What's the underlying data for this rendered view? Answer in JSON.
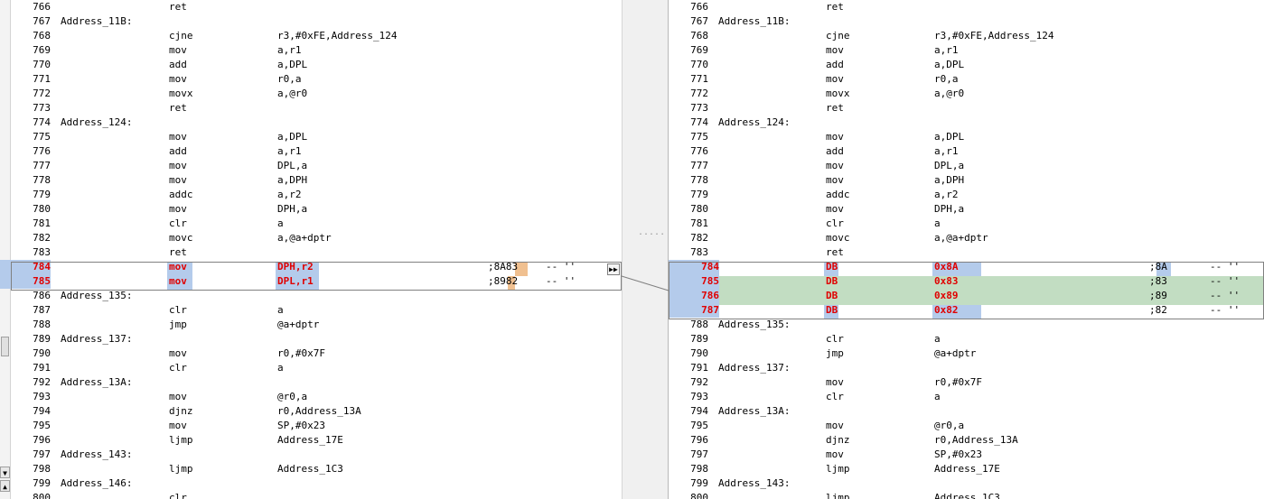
{
  "left": {
    "rows": [
      {
        "ln": "766",
        "label": "",
        "mn": "ret",
        "op": "",
        "cm": "",
        "as": ""
      },
      {
        "ln": "767",
        "label": "Address_11B:",
        "mn": "",
        "op": "",
        "cm": "",
        "as": ""
      },
      {
        "ln": "768",
        "label": "",
        "mn": "cjne",
        "op": "r3,#0xFE,Address_124",
        "cm": "",
        "as": ""
      },
      {
        "ln": "769",
        "label": "",
        "mn": "mov",
        "op": "a,r1",
        "cm": "",
        "as": ""
      },
      {
        "ln": "770",
        "label": "",
        "mn": "add",
        "op": "a,DPL",
        "cm": "",
        "as": ""
      },
      {
        "ln": "771",
        "label": "",
        "mn": "mov",
        "op": "r0,a",
        "cm": "",
        "as": ""
      },
      {
        "ln": "772",
        "label": "",
        "mn": "movx",
        "op": "a,@r0",
        "cm": "",
        "as": ""
      },
      {
        "ln": "773",
        "label": "",
        "mn": "ret",
        "op": "",
        "cm": "",
        "as": ""
      },
      {
        "ln": "774",
        "label": "Address_124:",
        "mn": "",
        "op": "",
        "cm": "",
        "as": ""
      },
      {
        "ln": "775",
        "label": "",
        "mn": "mov",
        "op": "a,DPL",
        "cm": "",
        "as": ""
      },
      {
        "ln": "776",
        "label": "",
        "mn": "add",
        "op": "a,r1",
        "cm": "",
        "as": ""
      },
      {
        "ln": "777",
        "label": "",
        "mn": "mov",
        "op": "DPL,a",
        "cm": "",
        "as": ""
      },
      {
        "ln": "778",
        "label": "",
        "mn": "mov",
        "op": "a,DPH",
        "cm": "",
        "as": ""
      },
      {
        "ln": "779",
        "label": "",
        "mn": "addc",
        "op": "a,r2",
        "cm": "",
        "as": ""
      },
      {
        "ln": "780",
        "label": "",
        "mn": "mov",
        "op": "DPH,a",
        "cm": "",
        "as": ""
      },
      {
        "ln": "781",
        "label": "",
        "mn": "clr",
        "op": "a",
        "cm": "",
        "as": ""
      },
      {
        "ln": "782",
        "label": "",
        "mn": "movc",
        "op": "a,@a+dptr",
        "cm": "",
        "as": ""
      },
      {
        "ln": "783",
        "label": "",
        "mn": "ret",
        "op": "",
        "cm": "",
        "as": ""
      },
      {
        "ln": "784",
        "label": "",
        "mn": "mov",
        "op": "DPH,r2",
        "cm": ";8A83",
        "as": "-- ''",
        "diff": true
      },
      {
        "ln": "785",
        "label": "",
        "mn": "mov",
        "op": "DPL,r1",
        "cm": ";8982",
        "as": "-- ''",
        "diff": true
      },
      {
        "ln": "786",
        "label": "Address_135:",
        "mn": "",
        "op": "",
        "cm": "",
        "as": ""
      },
      {
        "ln": "787",
        "label": "",
        "mn": "clr",
        "op": "a",
        "cm": "",
        "as": ""
      },
      {
        "ln": "788",
        "label": "",
        "mn": "jmp",
        "op": "@a+dptr",
        "cm": "",
        "as": ""
      },
      {
        "ln": "789",
        "label": "Address_137:",
        "mn": "",
        "op": "",
        "cm": "",
        "as": ""
      },
      {
        "ln": "790",
        "label": "",
        "mn": "mov",
        "op": "r0,#0x7F",
        "cm": "",
        "as": ""
      },
      {
        "ln": "791",
        "label": "",
        "mn": "clr",
        "op": "a",
        "cm": "",
        "as": ""
      },
      {
        "ln": "792",
        "label": "Address_13A:",
        "mn": "",
        "op": "",
        "cm": "",
        "as": ""
      },
      {
        "ln": "793",
        "label": "",
        "mn": "mov",
        "op": "@r0,a",
        "cm": "",
        "as": ""
      },
      {
        "ln": "794",
        "label": "",
        "mn": "djnz",
        "op": "r0,Address_13A",
        "cm": "",
        "as": ""
      },
      {
        "ln": "795",
        "label": "",
        "mn": "mov",
        "op": "SP,#0x23",
        "cm": "",
        "as": ""
      },
      {
        "ln": "796",
        "label": "",
        "mn": "ljmp",
        "op": "Address_17E",
        "cm": "",
        "as": ""
      },
      {
        "ln": "797",
        "label": "Address_143:",
        "mn": "",
        "op": "",
        "cm": "",
        "as": ""
      },
      {
        "ln": "798",
        "label": "",
        "mn": "ljmp",
        "op": "Address_1C3",
        "cm": "",
        "as": ""
      },
      {
        "ln": "799",
        "label": "Address_146:",
        "mn": "",
        "op": "",
        "cm": "",
        "as": ""
      },
      {
        "ln": "800",
        "label": "",
        "mn": "clr",
        "op": "",
        "cm": "",
        "as": ""
      }
    ]
  },
  "right": {
    "rows": [
      {
        "ln": "766",
        "label": "",
        "mn": "ret",
        "op": "",
        "cm": "",
        "as": ""
      },
      {
        "ln": "767",
        "label": "Address_11B:",
        "mn": "",
        "op": "",
        "cm": "",
        "as": ""
      },
      {
        "ln": "768",
        "label": "",
        "mn": "cjne",
        "op": "r3,#0xFE,Address_124",
        "cm": "",
        "as": ""
      },
      {
        "ln": "769",
        "label": "",
        "mn": "mov",
        "op": "a,r1",
        "cm": "",
        "as": ""
      },
      {
        "ln": "770",
        "label": "",
        "mn": "add",
        "op": "a,DPL",
        "cm": "",
        "as": ""
      },
      {
        "ln": "771",
        "label": "",
        "mn": "mov",
        "op": "r0,a",
        "cm": "",
        "as": ""
      },
      {
        "ln": "772",
        "label": "",
        "mn": "movx",
        "op": "a,@r0",
        "cm": "",
        "as": ""
      },
      {
        "ln": "773",
        "label": "",
        "mn": "ret",
        "op": "",
        "cm": "",
        "as": ""
      },
      {
        "ln": "774",
        "label": "Address_124:",
        "mn": "",
        "op": "",
        "cm": "",
        "as": ""
      },
      {
        "ln": "775",
        "label": "",
        "mn": "mov",
        "op": "a,DPL",
        "cm": "",
        "as": ""
      },
      {
        "ln": "776",
        "label": "",
        "mn": "add",
        "op": "a,r1",
        "cm": "",
        "as": ""
      },
      {
        "ln": "777",
        "label": "",
        "mn": "mov",
        "op": "DPL,a",
        "cm": "",
        "as": ""
      },
      {
        "ln": "778",
        "label": "",
        "mn": "mov",
        "op": "a,DPH",
        "cm": "",
        "as": ""
      },
      {
        "ln": "779",
        "label": "",
        "mn": "addc",
        "op": "a,r2",
        "cm": "",
        "as": ""
      },
      {
        "ln": "780",
        "label": "",
        "mn": "mov",
        "op": "DPH,a",
        "cm": "",
        "as": ""
      },
      {
        "ln": "781",
        "label": "",
        "mn": "clr",
        "op": "a",
        "cm": "",
        "as": ""
      },
      {
        "ln": "782",
        "label": "",
        "mn": "movc",
        "op": "a,@a+dptr",
        "cm": "",
        "as": ""
      },
      {
        "ln": "783",
        "label": "",
        "mn": "ret",
        "op": "",
        "cm": "",
        "as": ""
      },
      {
        "ln": "784",
        "label": "",
        "mn": "DB",
        "op": "0x8A",
        "cm": ";8A",
        "as": "-- ''",
        "diff": true
      },
      {
        "ln": "785",
        "label": "",
        "mn": "DB",
        "op": "0x83",
        "cm": ";83",
        "as": "-- ''",
        "diff": true,
        "added": true
      },
      {
        "ln": "786",
        "label": "",
        "mn": "DB",
        "op": "0x89",
        "cm": ";89",
        "as": "-- ''",
        "diff": true,
        "added": true
      },
      {
        "ln": "787",
        "label": "",
        "mn": "DB",
        "op": "0x82",
        "cm": ";82",
        "as": "-- ''",
        "diff": true
      },
      {
        "ln": "788",
        "label": "Address_135:",
        "mn": "",
        "op": "",
        "cm": "",
        "as": ""
      },
      {
        "ln": "789",
        "label": "",
        "mn": "clr",
        "op": "a",
        "cm": "",
        "as": ""
      },
      {
        "ln": "790",
        "label": "",
        "mn": "jmp",
        "op": "@a+dptr",
        "cm": "",
        "as": ""
      },
      {
        "ln": "791",
        "label": "Address_137:",
        "mn": "",
        "op": "",
        "cm": "",
        "as": ""
      },
      {
        "ln": "792",
        "label": "",
        "mn": "mov",
        "op": "r0,#0x7F",
        "cm": "",
        "as": ""
      },
      {
        "ln": "793",
        "label": "",
        "mn": "clr",
        "op": "a",
        "cm": "",
        "as": ""
      },
      {
        "ln": "794",
        "label": "Address_13A:",
        "mn": "",
        "op": "",
        "cm": "",
        "as": ""
      },
      {
        "ln": "795",
        "label": "",
        "mn": "mov",
        "op": "@r0,a",
        "cm": "",
        "as": ""
      },
      {
        "ln": "796",
        "label": "",
        "mn": "djnz",
        "op": "r0,Address_13A",
        "cm": "",
        "as": ""
      },
      {
        "ln": "797",
        "label": "",
        "mn": "mov",
        "op": "SP,#0x23",
        "cm": "",
        "as": ""
      },
      {
        "ln": "798",
        "label": "",
        "mn": "ljmp",
        "op": "Address_17E",
        "cm": "",
        "as": ""
      },
      {
        "ln": "799",
        "label": "Address_143:",
        "mn": "",
        "op": "",
        "cm": "",
        "as": ""
      },
      {
        "ln": "800",
        "label": "",
        "mn": "ljmp",
        "op": "Address_1C3",
        "cm": "",
        "as": ""
      }
    ]
  },
  "scroll": {
    "up_icon": "scroll-up-icon",
    "down_icon": "scroll-down-icon",
    "up_glyph": "▲",
    "down_glyph": "▼"
  },
  "gutter": {
    "grip": "....."
  },
  "nav": {
    "next_diff_glyph": "▶▶"
  },
  "colors": {
    "diff_text": "#e00000",
    "changed_bg": "#b4cbeb",
    "added_bg": "#c2ddc2",
    "byte_highlight": "#f0c090"
  }
}
